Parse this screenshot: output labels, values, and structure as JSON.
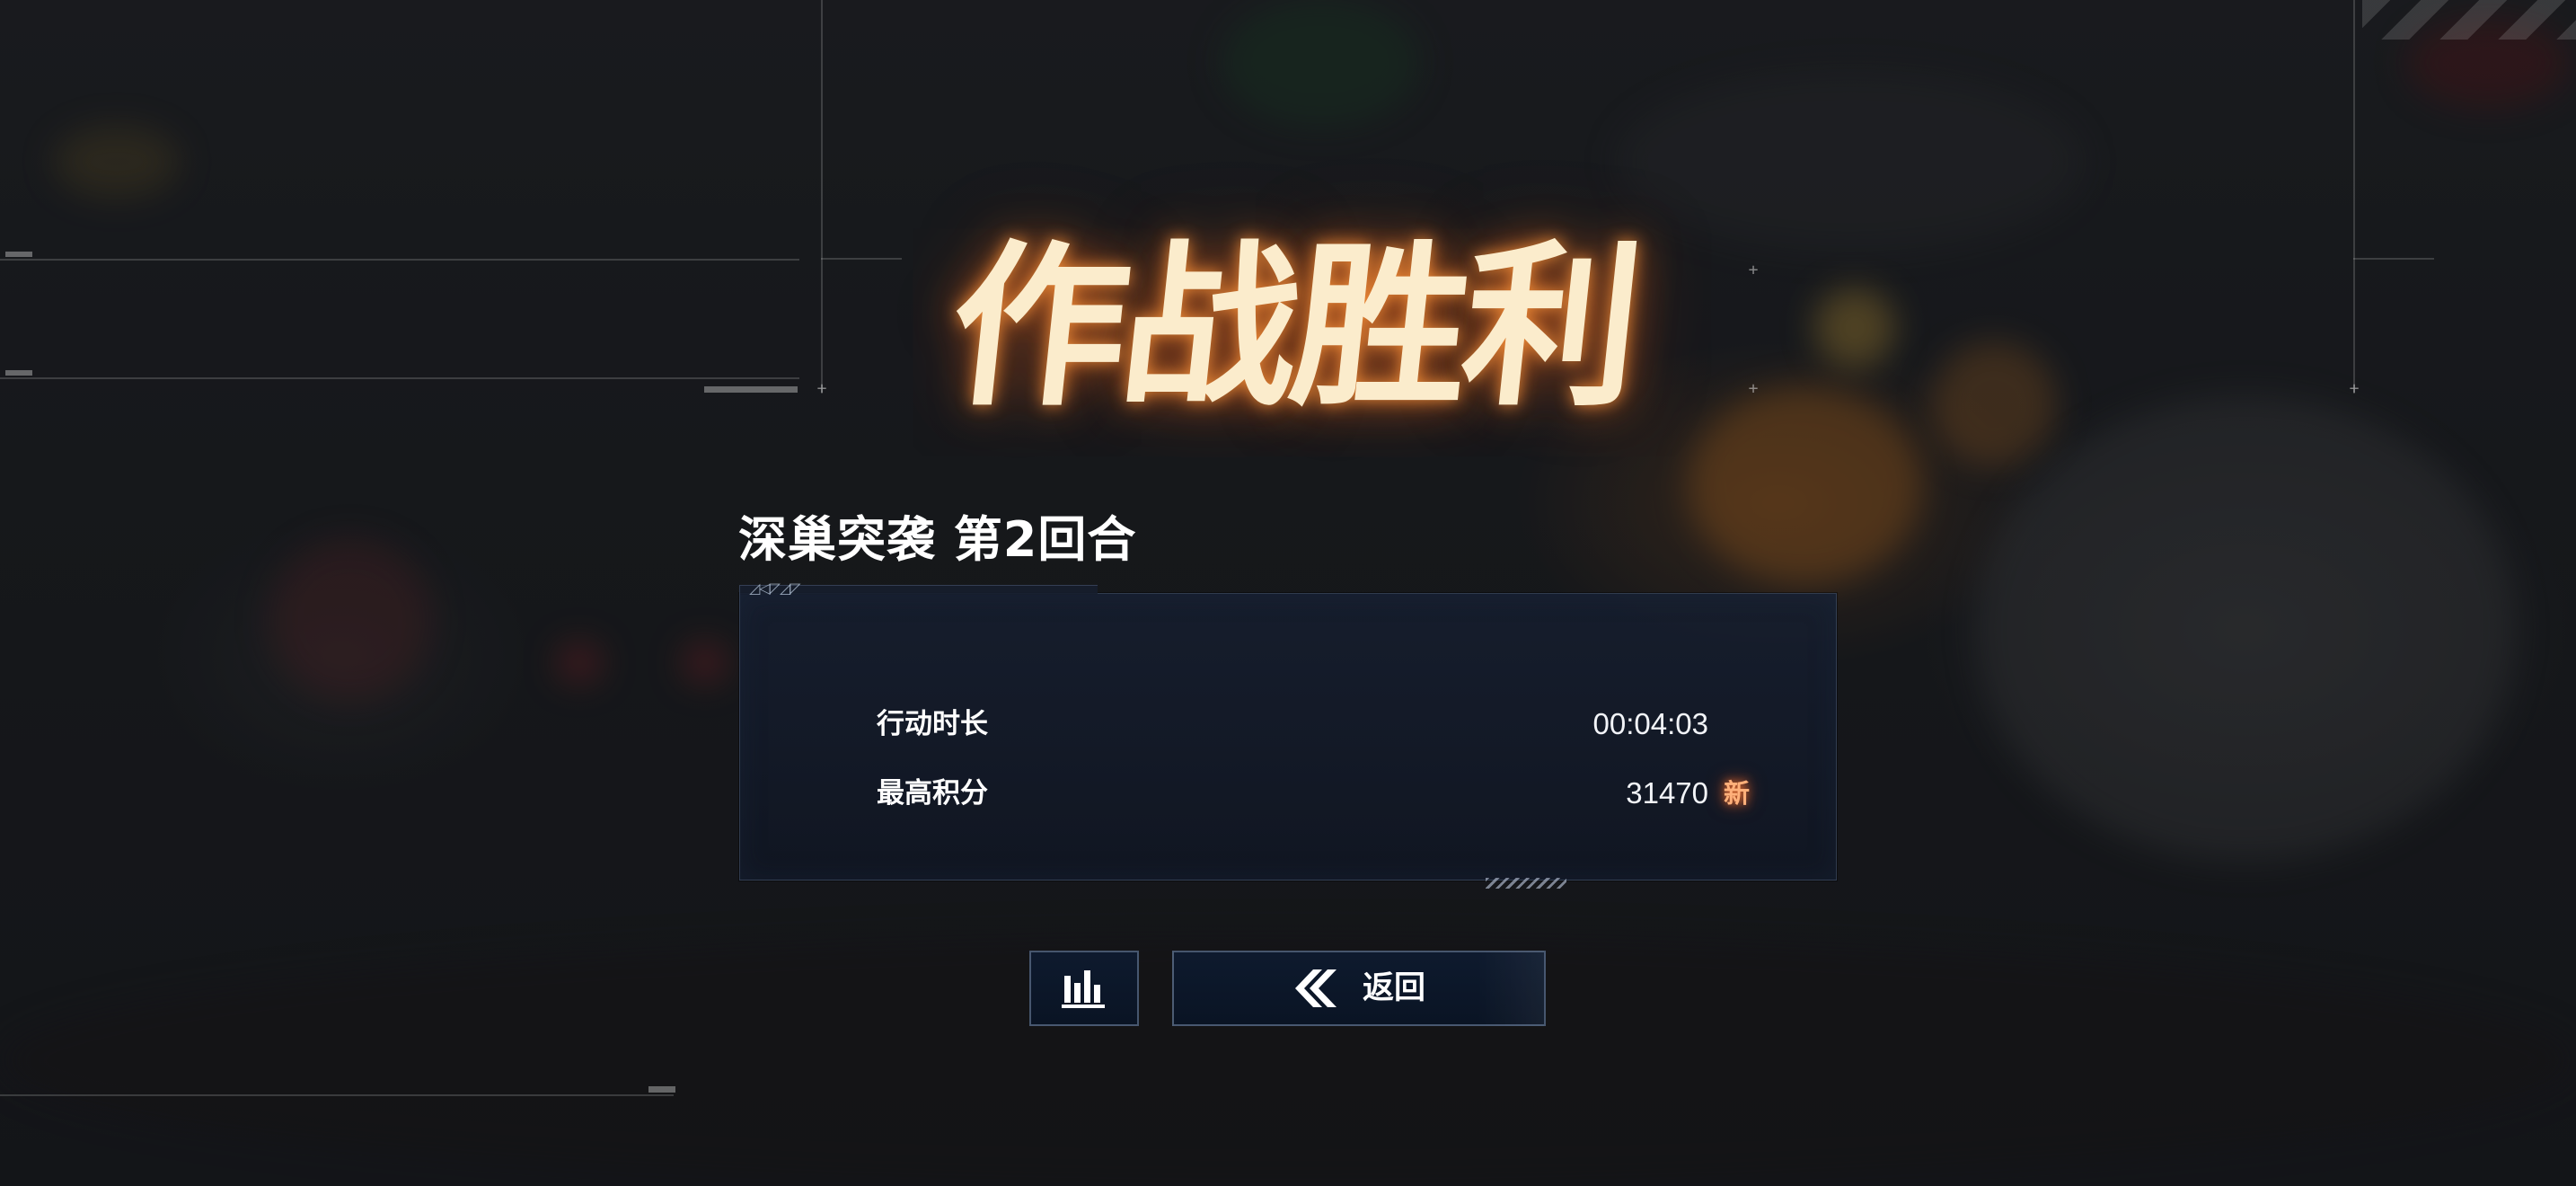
{
  "result": {
    "title": "作战胜利",
    "stage_title": "深巢突袭 第2回合"
  },
  "stats": [
    {
      "label": "行动时长",
      "value": "00:04:03",
      "badge": ""
    },
    {
      "label": "最高积分",
      "value": "31470",
      "badge": "新"
    }
  ],
  "panel": {
    "corner_marks": "◿◁◸◿◸"
  },
  "buttons": {
    "stats_icon": "bar-chart-icon",
    "back_icon": "double-chevron-left-icon",
    "back_label": "返回"
  },
  "colors": {
    "title": "#fbeccc",
    "title_glow": "#ff8a2e",
    "new_badge": "#ffb07a",
    "panel_bg": "#141d2d",
    "button_bg": "#0e1a2e"
  }
}
